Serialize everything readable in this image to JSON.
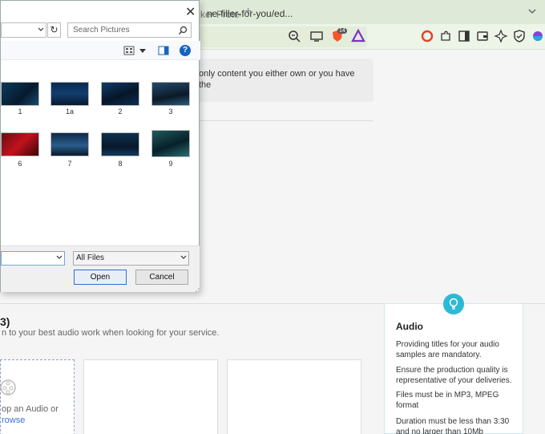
{
  "browser": {
    "tab_title": "ker Protec",
    "url": "ne-filler-for-you/ed...",
    "brave_badge": "14"
  },
  "page": {
    "notice_text": "only content you either own or you have the",
    "section_title": "3)",
    "section_subtitle": "n to your best audio work when looking for your service.",
    "upload_line1": "op an Audio or",
    "upload_line2": "rowse"
  },
  "tips": {
    "title": "Audio",
    "items": [
      "Providing titles for your audio samples are mandatory.",
      "Ensure the production quality is representative of your deliveries.",
      "Files must be in MP3, MPEG format",
      "Duration must be less than 3:30 and no larger than 10Mb"
    ]
  },
  "dialog": {
    "search_placeholder": "Search Pictures",
    "thumbnails": [
      "1",
      "1a",
      "2",
      "3",
      "6",
      "7",
      "8",
      "9"
    ],
    "filename_value": "",
    "filter_value": "All Files",
    "open_label": "Open",
    "cancel_label": "Cancel"
  },
  "colors": {
    "tabbar_bg": "#dfe9d8",
    "accent_blue": "#2a6fd1",
    "tip_accent": "#2bb9d6"
  }
}
